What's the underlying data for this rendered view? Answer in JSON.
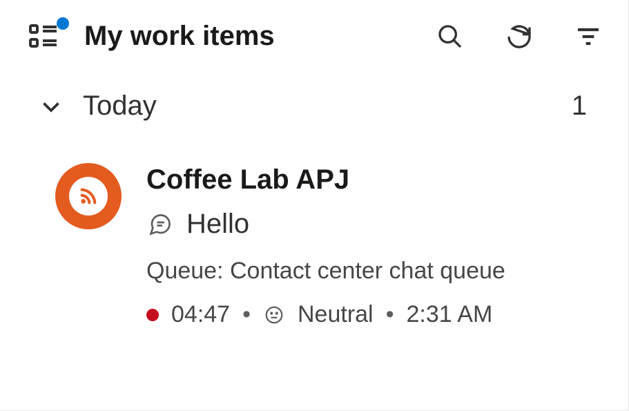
{
  "header": {
    "title": "My work items"
  },
  "section": {
    "label": "Today",
    "count": "1"
  },
  "item": {
    "name": "Coffee Lab APJ",
    "message": "Hello",
    "queue": "Queue: Contact center chat queue",
    "duration": "04:47",
    "sentiment": "Neutral",
    "time": "2:31 AM",
    "sep": "•"
  }
}
